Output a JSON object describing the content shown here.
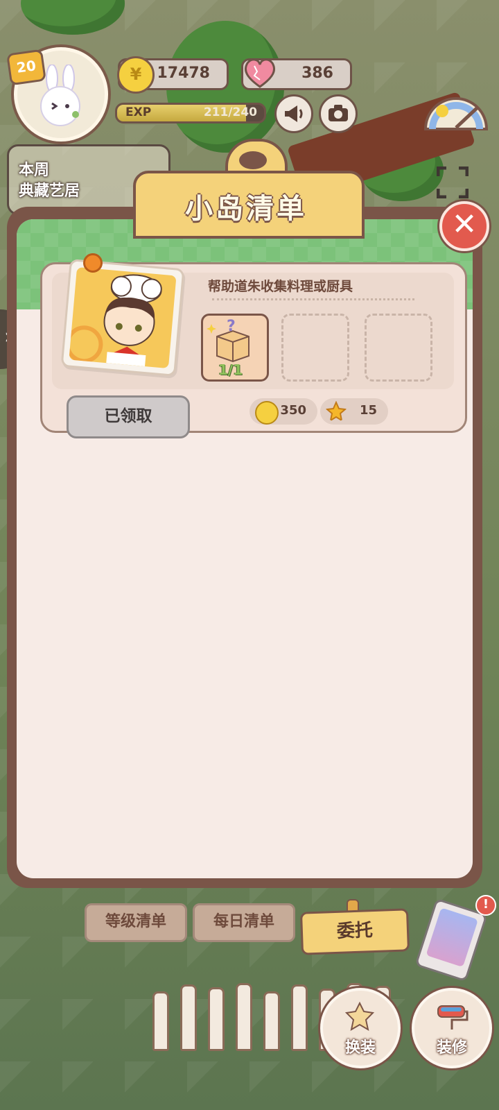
{
  "hud": {
    "level": "20",
    "coins": "17478",
    "hearts": "386",
    "exp_label": "EXP",
    "exp_value": "211/240",
    "exp_fraction": 0.879,
    "weekly_banner": [
      "本周",
      "典藏艺居"
    ]
  },
  "panel": {
    "title": "小岛清单",
    "task": {
      "description": "帮助道朱收集料理或厨具",
      "item_count": "1/1",
      "status_button": "已领取",
      "rewards": [
        {
          "icon": "coin-icon",
          "value": "350"
        },
        {
          "icon": "star-icon",
          "value": "15"
        }
      ]
    }
  },
  "tabs": {
    "level_list": "等级清单",
    "daily_list": "每日清单",
    "commission": "委托"
  },
  "actions": {
    "outfit": "换装",
    "decorate": "装修"
  },
  "colors": {
    "panel_brown": "#7a5548",
    "title_yellow": "#f4d27a",
    "header_green": "#7cc27a",
    "close_red": "#e25a4e"
  }
}
